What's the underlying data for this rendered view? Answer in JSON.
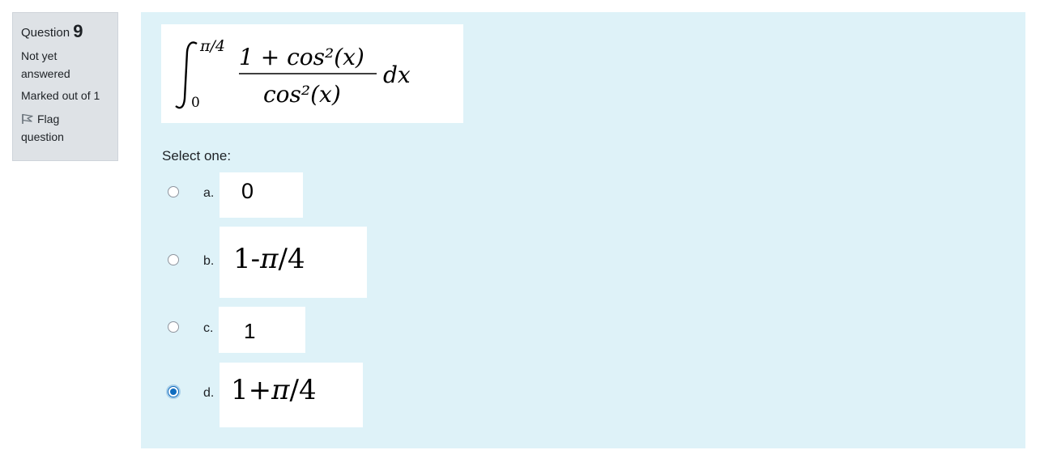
{
  "info": {
    "question_label": "Question",
    "question_number": "9",
    "state_line1": "Not yet",
    "state_line2": "answered",
    "grade": "Marked out of 1",
    "flag_line1": "Flag",
    "flag_line2": "question"
  },
  "question": {
    "integral": {
      "upper_limit": "π/4",
      "lower_limit": "0",
      "numerator": "1 + cos²(x)",
      "denominator": "cos²(x)",
      "differential": "dx"
    },
    "prompt": "Select one:"
  },
  "options": [
    {
      "letter": "a.",
      "pre": "0",
      "pi": "",
      "post": "",
      "checked": false
    },
    {
      "letter": "b.",
      "pre": "1-",
      "pi": "π",
      "post": "/4",
      "checked": false
    },
    {
      "letter": "c.",
      "pre": "1",
      "pi": "",
      "post": "",
      "checked": false
    },
    {
      "letter": "d.",
      "pre": "1+",
      "pi": "π",
      "post": "/4",
      "checked": true
    }
  ],
  "colors": {
    "info_bg": "#dee2e6",
    "content_bg": "#def2f8",
    "radio_selected": "#0f6cbf"
  }
}
